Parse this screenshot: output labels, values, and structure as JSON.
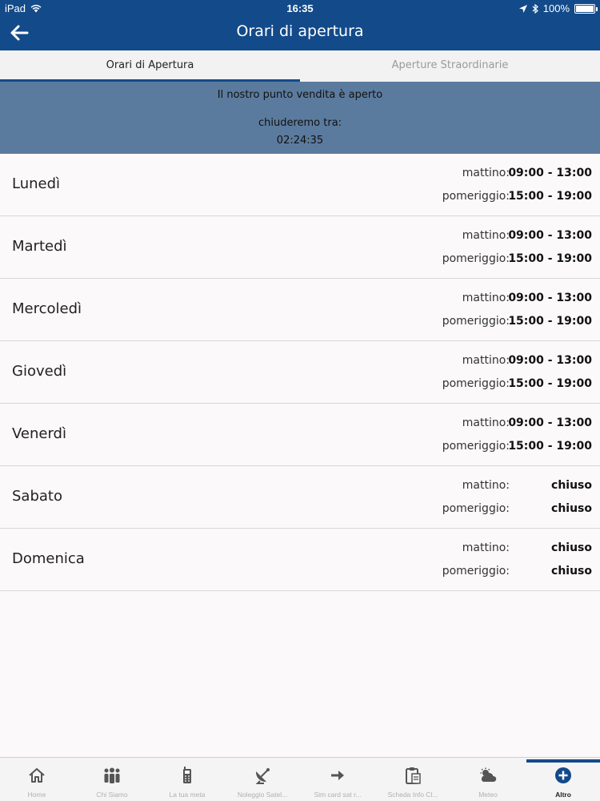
{
  "status_bar": {
    "device": "iPad",
    "time": "16:35",
    "battery": "100%"
  },
  "nav": {
    "title": "Orari di apertura"
  },
  "tabs": {
    "active": "Orari di Apertura",
    "inactive": "Aperture Straordinarie"
  },
  "banner": {
    "line1": "Il nostro punto vendita è aperto",
    "line2": "chiuderemo tra:",
    "countdown": "02:24:35"
  },
  "labels": {
    "morning": "mattino:",
    "afternoon": "pomeriggio:"
  },
  "days": [
    {
      "name": "Lunedì",
      "morning": "09:00 - 13:00",
      "afternoon": "15:00 - 19:00"
    },
    {
      "name": "Martedì",
      "morning": "09:00 - 13:00",
      "afternoon": "15:00 - 19:00"
    },
    {
      "name": "Mercoledì",
      "morning": "09:00 - 13:00",
      "afternoon": "15:00 - 19:00"
    },
    {
      "name": "Giovedì",
      "morning": "09:00 - 13:00",
      "afternoon": "15:00 - 19:00"
    },
    {
      "name": "Venerdì",
      "morning": "09:00 - 13:00",
      "afternoon": "15:00 - 19:00"
    },
    {
      "name": "Sabato",
      "morning": "chiuso",
      "afternoon": "chiuso"
    },
    {
      "name": "Domenica",
      "morning": "chiuso",
      "afternoon": "chiuso"
    }
  ],
  "tab_bar": [
    {
      "label": "Home",
      "icon": "home-icon"
    },
    {
      "label": "Chi Siamo",
      "icon": "people-icon"
    },
    {
      "label": "La tua meta",
      "icon": "satellite-phone-icon"
    },
    {
      "label": "Noleggio Satel...",
      "icon": "satellite-dish-icon"
    },
    {
      "label": "Sim card sat r...",
      "icon": "arrow-right-icon"
    },
    {
      "label": "Scheda Info Cl...",
      "icon": "clipboard-icon"
    },
    {
      "label": "Meteo",
      "icon": "weather-icon"
    },
    {
      "label": "Altro",
      "icon": "plus-circle-icon"
    }
  ],
  "colors": {
    "primary": "#134a8a",
    "banner": "#5b7b9e",
    "background": "#fbf9f9"
  }
}
